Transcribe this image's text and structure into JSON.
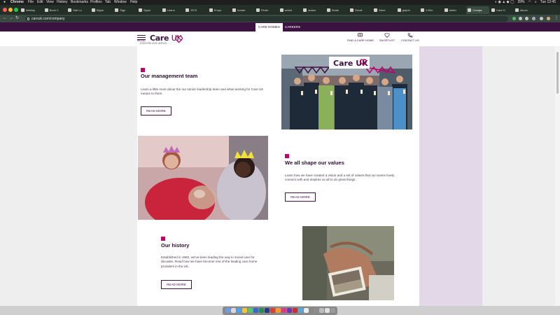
{
  "menubar": {
    "app": "Chrome",
    "items": [
      "File",
      "Edit",
      "View",
      "History",
      "Bookmarks",
      "Profiles",
      "Tab",
      "Window",
      "Help"
    ],
    "battery": "39%",
    "clock": "Tue 12:45"
  },
  "tabs": [
    {
      "label": "Weekly"
    },
    {
      "label": "Book C"
    },
    {
      "label": "Sab Lo"
    },
    {
      "label": "Signe"
    },
    {
      "label": "Sign"
    },
    {
      "label": "Signe"
    },
    {
      "label": "Learni"
    },
    {
      "label": "2570"
    },
    {
      "label": "Empo"
    },
    {
      "label": "tender"
    },
    {
      "label": "Pinter"
    },
    {
      "label": "webct"
    },
    {
      "label": "autum"
    },
    {
      "label": "Stude"
    },
    {
      "label": "Email"
    },
    {
      "label": "Store"
    },
    {
      "label": "graphi"
    },
    {
      "label": "9 Elm"
    },
    {
      "label": "better"
    },
    {
      "label": "Compa"
    },
    {
      "label": "Care H"
    },
    {
      "label": "discov"
    }
  ],
  "address": {
    "url": "careuk.com/company"
  },
  "site": {
    "top_nav": {
      "care_homes": "CARE HOMES",
      "careers": "CAREERS"
    },
    "menu_label": "MENU",
    "logo": {
      "care": "Care",
      "uk": "UK"
    },
    "header_links": {
      "find": "FIND A CARE HOME",
      "shortlist": "SHORTLIST",
      "contact": "CONTACT US"
    },
    "cut_text": "Interests and wishes",
    "sections": [
      {
        "heading": "Our management team",
        "body": "Learn a little more about the our senior leadership team and what working for Care UK means to them.",
        "button": "READ MORE"
      },
      {
        "heading": "We all shape our values",
        "body": "Learn how we have created a vision and a set of values that our teams truely connect with and inspires us all to do great things.",
        "button": "READ MORE"
      },
      {
        "heading": "Our history",
        "body": "Established in 1982, we've been leading the way in social care for decades. Read how we have become one of the leading care home providers in the UK.",
        "button": "READ MORE"
      }
    ],
    "photo_banner_text": "Care UK"
  },
  "colors": {
    "brand_purple": "#3c1340",
    "accent_magenta": "#c2006e",
    "lilac_panel": "#e2d8e7"
  }
}
